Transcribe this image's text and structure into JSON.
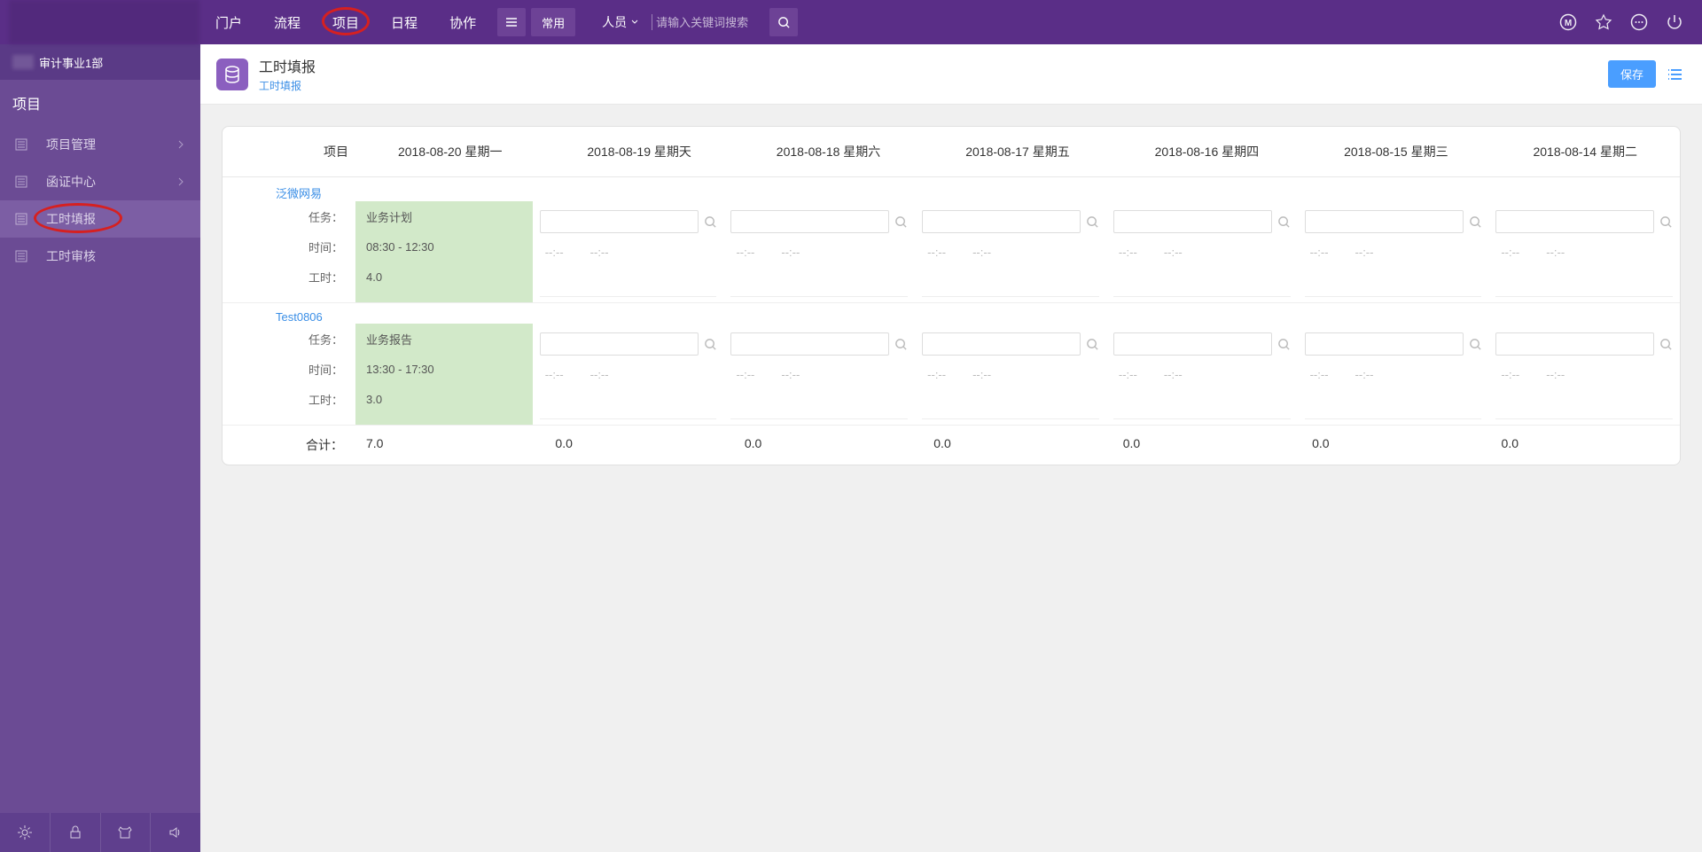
{
  "nav": {
    "items": [
      "门户",
      "流程",
      "项目",
      "日程",
      "协作"
    ],
    "active_index": 2,
    "common_label": "常用"
  },
  "search": {
    "type_label": "人员",
    "placeholder": "请输入关键词搜索"
  },
  "sidebar": {
    "dept": "审计事业1部",
    "title": "项目",
    "items": [
      {
        "label": "项目管理",
        "has_children": true
      },
      {
        "label": "函证中心",
        "has_children": true
      },
      {
        "label": "工时填报",
        "has_children": false,
        "selected": true,
        "circled": true
      },
      {
        "label": "工时审核",
        "has_children": false
      }
    ]
  },
  "page": {
    "title": "工时填报",
    "breadcrumb": "工时填报",
    "save_label": "保存"
  },
  "table": {
    "project_header": "项目",
    "row_labels": {
      "task": "任务：",
      "time": "时间：",
      "hours": "工时："
    },
    "time_placeholder": "--:--",
    "days": [
      "2018-08-20 星期一",
      "2018-08-19 星期天",
      "2018-08-18 星期六",
      "2018-08-17 星期五",
      "2018-08-16 星期四",
      "2018-08-15 星期三",
      "2018-08-14 星期二"
    ],
    "projects": [
      {
        "name": "泛微网易",
        "entries": {
          "0": {
            "task": "业务计划",
            "time": "08:30 - 12:30",
            "hours": "4.0"
          }
        }
      },
      {
        "name": "Test0806",
        "entries": {
          "0": {
            "task": "业务报告",
            "time": "13:30 - 17:30",
            "hours": "3.0"
          }
        }
      }
    ],
    "total_label": "合计：",
    "totals": [
      "7.0",
      "0.0",
      "0.0",
      "0.0",
      "0.0",
      "0.0",
      "0.0"
    ]
  }
}
